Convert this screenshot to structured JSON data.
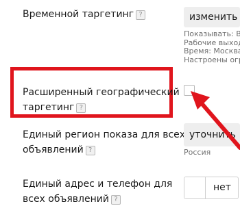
{
  "time_targeting": {
    "label": "Временной таргетинг",
    "help": "?",
    "button": "изменить",
    "details": [
      "Показывать: Все",
      "Рабочие выходные",
      "Время: Москва",
      "Настроены ограничения"
    ]
  },
  "geo_targeting": {
    "label_line1": "Расширенный географический",
    "label_line2": "таргетинг",
    "help": "?",
    "checked": false
  },
  "region": {
    "label_line1": "Единый регион показа для всех",
    "label_line2": "объявлений",
    "help": "?",
    "button": "уточнить",
    "note": "Россия"
  },
  "address": {
    "label_line1": "Единый адрес и телефон для",
    "label_line2": "всех объявлений",
    "help": "?",
    "toggle": "нет"
  },
  "annotation": {
    "highlight_color": "#e0151d",
    "arrow_color": "#e0151d"
  }
}
